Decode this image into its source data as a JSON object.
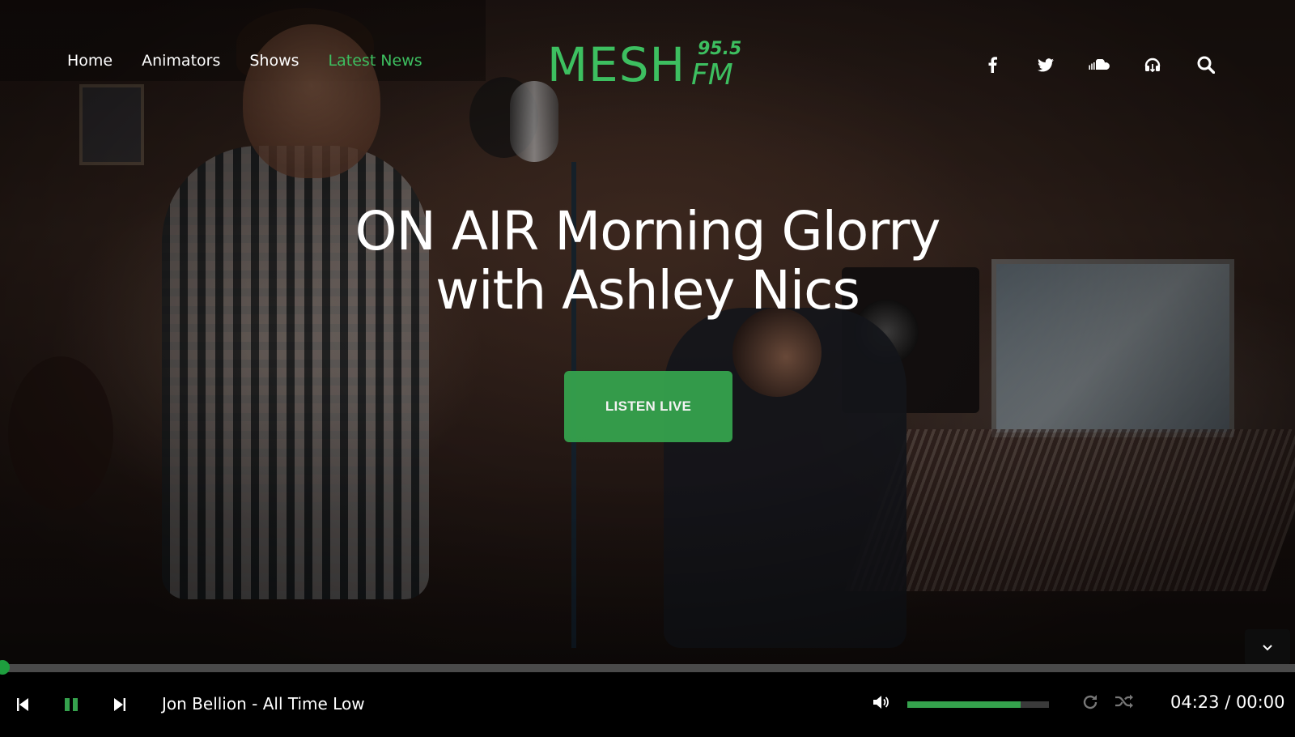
{
  "nav": {
    "items": [
      {
        "label": "Home",
        "active": false
      },
      {
        "label": "Animators",
        "active": false
      },
      {
        "label": "Shows",
        "active": false
      },
      {
        "label": "Latest News",
        "active": true
      }
    ]
  },
  "logo": {
    "name": "MESH",
    "frequency": "95.5",
    "band": "FM"
  },
  "social": [
    "facebook-icon",
    "twitter-icon",
    "soundcloud-icon",
    "headphones-icon",
    "search-icon"
  ],
  "hero": {
    "headline_line1": "ON AIR Morning Glorry",
    "headline_line2": "with Ashley Nics",
    "cta_label": "LISTEN LIVE"
  },
  "player": {
    "track": "Jon Bellion - All Time Low",
    "time": "04:23 / 00:00",
    "progress_fraction": 0.0,
    "volume_fraction": 0.8
  },
  "colors": {
    "accent": "#3dbf60",
    "button": "#35a24d",
    "player_bg": "#000000"
  }
}
